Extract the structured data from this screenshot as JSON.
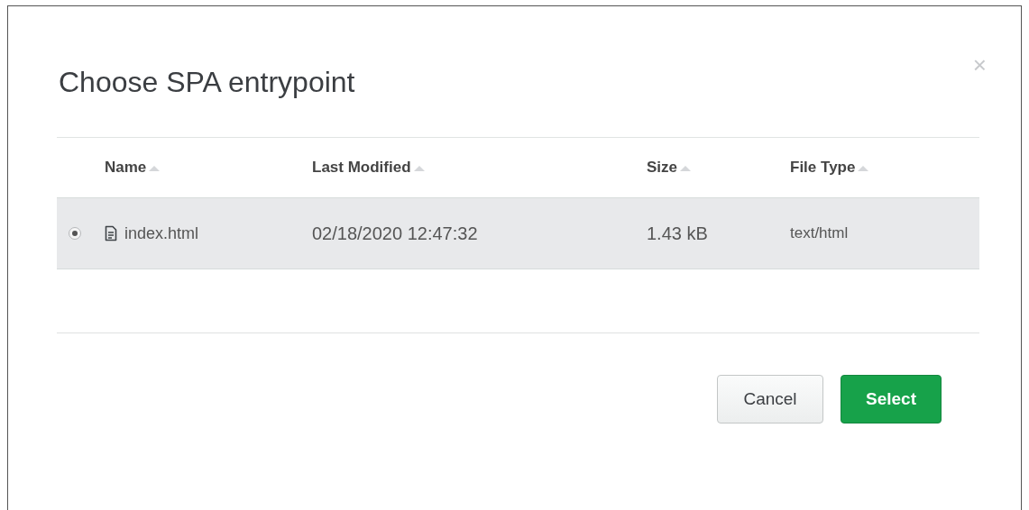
{
  "dialog": {
    "title": "Choose SPA entrypoint",
    "close": "×"
  },
  "table": {
    "columns": [
      {
        "label": "Name"
      },
      {
        "label": "Last Modified"
      },
      {
        "label": "Size"
      },
      {
        "label": "File Type"
      }
    ],
    "rows": [
      {
        "selected": true,
        "name": "index.html",
        "modified": "02/18/2020 12:47:32",
        "size": "1.43 kB",
        "type": "text/html"
      }
    ]
  },
  "buttons": [
    {
      "kind": "secondary",
      "label": "Cancel"
    },
    {
      "kind": "primary",
      "label": "Select"
    }
  ]
}
